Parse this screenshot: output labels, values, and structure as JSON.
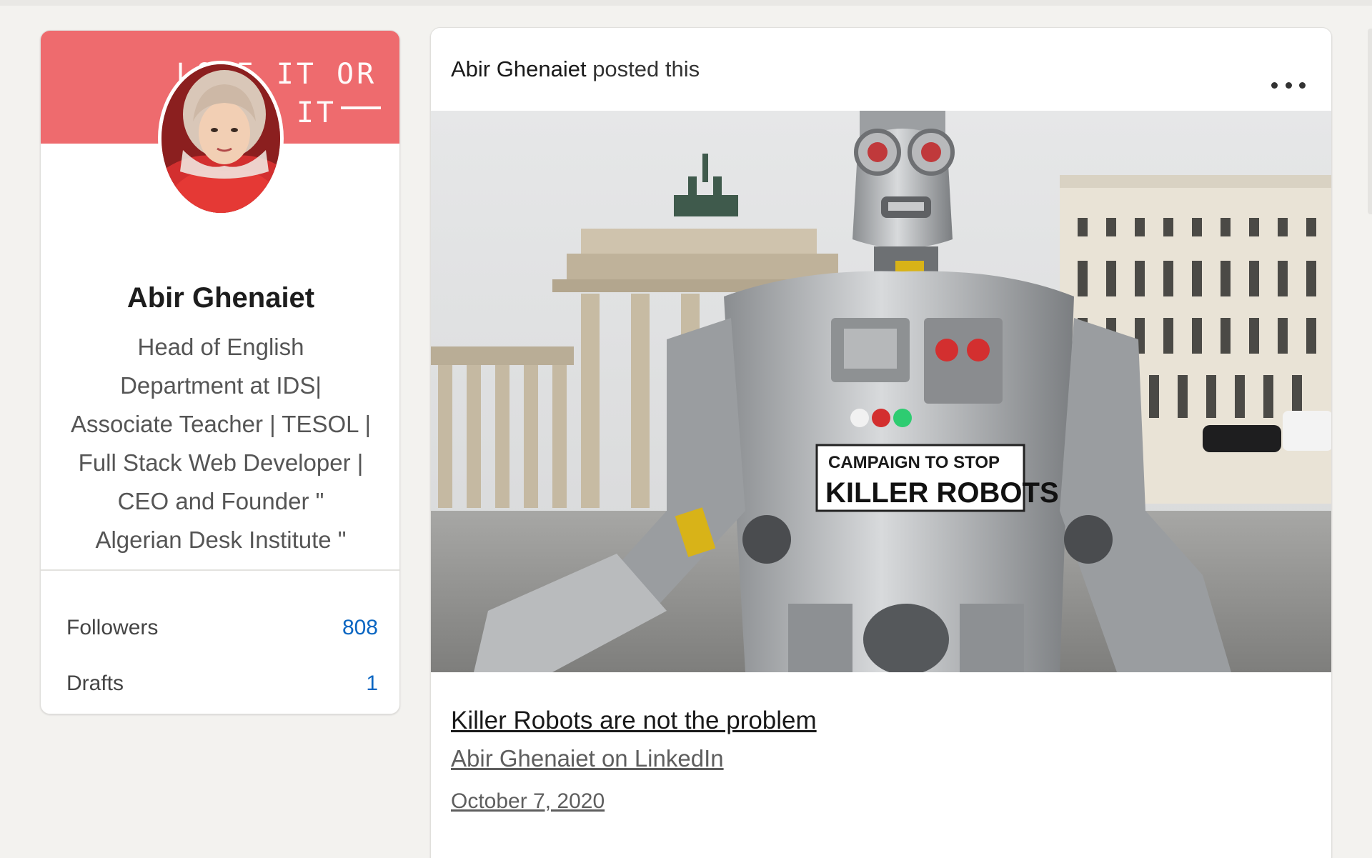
{
  "profile": {
    "cover_text_line1": "LOVE IT OR",
    "cover_text_line2": "LEAVE IT",
    "name": "Abir Ghenaiet",
    "headline_lines": [
      "Head of English",
      "Department at IDS|",
      "Associate Teacher | TESOL |",
      "Full Stack Web Developer |",
      "CEO and Founder \"",
      "Algerian Desk Institute \""
    ],
    "stats": [
      {
        "label": "Followers",
        "value": "808"
      },
      {
        "label": "Drafts",
        "value": "1"
      }
    ]
  },
  "post": {
    "author": "Abir Ghenaiet",
    "action": "posted this",
    "image_sign_line1": "CAMPAIGN TO STOP",
    "image_sign_line2": "KILLER ROBOTS",
    "title": "Killer Robots are not the problem",
    "source": "Abir Ghenaiet on LinkedIn",
    "date": "October 7, 2020"
  },
  "icons": {
    "more": "ellipsis-icon"
  },
  "colors": {
    "cover": "#ee6b6e",
    "link_blue": "#0a66c2",
    "background": "#f3f2ef"
  }
}
